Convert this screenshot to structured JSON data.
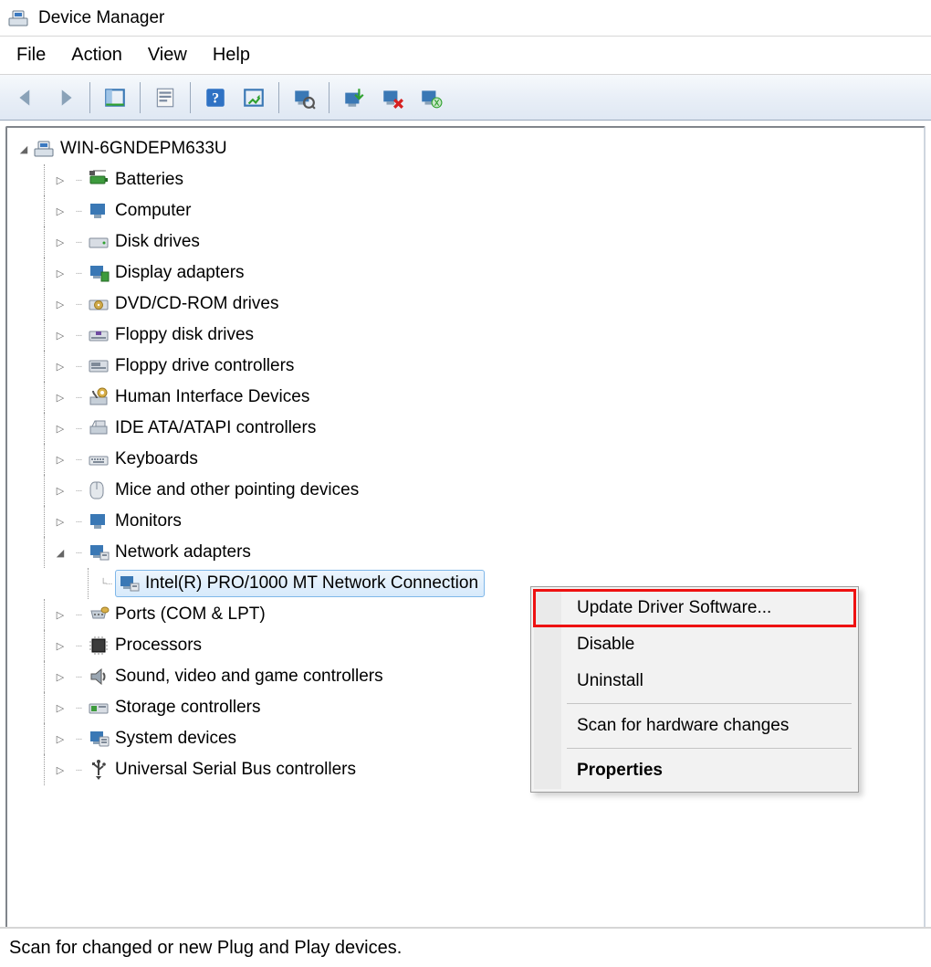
{
  "window": {
    "title": "Device Manager"
  },
  "menu": {
    "file": "File",
    "action": "Action",
    "view": "View",
    "help": "Help"
  },
  "toolbar_icons": {
    "back": "back-arrow-icon",
    "forward": "forward-arrow-icon",
    "show_hidden": "properties-pane-icon",
    "properties": "properties-icon",
    "help": "help-icon",
    "refresh": "refresh-icon",
    "scan": "scan-hardware-icon",
    "update": "update-driver-icon",
    "disable": "disable-device-icon",
    "uninstall": "uninstall-device-icon"
  },
  "tree": {
    "root": "WIN-6GNDEPM633U",
    "categories": [
      {
        "label": "Batteries",
        "expanded": false
      },
      {
        "label": "Computer",
        "expanded": false
      },
      {
        "label": "Disk drives",
        "expanded": false
      },
      {
        "label": "Display adapters",
        "expanded": false
      },
      {
        "label": "DVD/CD-ROM drives",
        "expanded": false
      },
      {
        "label": "Floppy disk drives",
        "expanded": false
      },
      {
        "label": "Floppy drive controllers",
        "expanded": false
      },
      {
        "label": "Human Interface Devices",
        "expanded": false
      },
      {
        "label": "IDE ATA/ATAPI controllers",
        "expanded": false
      },
      {
        "label": "Keyboards",
        "expanded": false
      },
      {
        "label": "Mice and other pointing devices",
        "expanded": false
      },
      {
        "label": "Monitors",
        "expanded": false
      },
      {
        "label": "Network adapters",
        "expanded": true,
        "children": [
          {
            "label": "Intel(R) PRO/1000 MT Network Connection",
            "selected": true
          }
        ]
      },
      {
        "label": "Ports (COM & LPT)",
        "expanded": false
      },
      {
        "label": "Processors",
        "expanded": false
      },
      {
        "label": "Sound, video and game controllers",
        "expanded": false
      },
      {
        "label": "Storage controllers",
        "expanded": false
      },
      {
        "label": "System devices",
        "expanded": false
      },
      {
        "label": "Universal Serial Bus controllers",
        "expanded": false
      }
    ]
  },
  "context_menu": {
    "items": [
      {
        "label": "Update Driver Software...",
        "highlight": true
      },
      {
        "label": "Disable"
      },
      {
        "label": "Uninstall"
      },
      {
        "sep": true
      },
      {
        "label": "Scan for hardware changes"
      },
      {
        "sep": true
      },
      {
        "label": "Properties",
        "bold": true
      }
    ]
  },
  "statusbar": {
    "text": "Scan for changed or new Plug and Play devices."
  }
}
